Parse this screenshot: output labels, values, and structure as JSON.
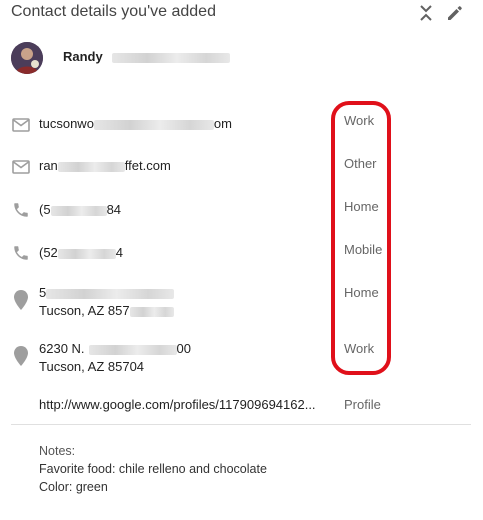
{
  "header": {
    "title": "Contact details you've added"
  },
  "person": {
    "name": "Randy"
  },
  "rows": [
    {
      "type": "email",
      "icon": "email-icon",
      "value_start": "tucsonwo",
      "value_end": "om",
      "label": "Work"
    },
    {
      "type": "email",
      "icon": "email-icon",
      "value_start": "ran",
      "value_end": "ffet.com",
      "label": "Other"
    },
    {
      "type": "phone",
      "icon": "phone-icon",
      "value_start": "(5",
      "value_end": "84",
      "label": "Home"
    },
    {
      "type": "phone",
      "icon": "phone-icon",
      "value_start": "(52",
      "value_end": "4",
      "label": "Mobile"
    },
    {
      "type": "address",
      "icon": "place-icon",
      "line1_start": "5",
      "line1_end": "",
      "line2": "Tucson, AZ 857",
      "label": "Home"
    },
    {
      "type": "address",
      "icon": "place-icon",
      "line1_start": "6230 N.",
      "line1_end": "00",
      "line2": "Tucson, AZ 85704",
      "label": "Work"
    },
    {
      "type": "url",
      "value": "http://www.google.com/profiles/117909694162...",
      "label": "Profile"
    }
  ],
  "notes": {
    "label": "Notes:",
    "line1": "Favorite food: chile relleno and chocolate",
    "line2": "Color: green"
  },
  "colors": {
    "highlight": "#e0101a",
    "icon": "#9e9e9e"
  }
}
